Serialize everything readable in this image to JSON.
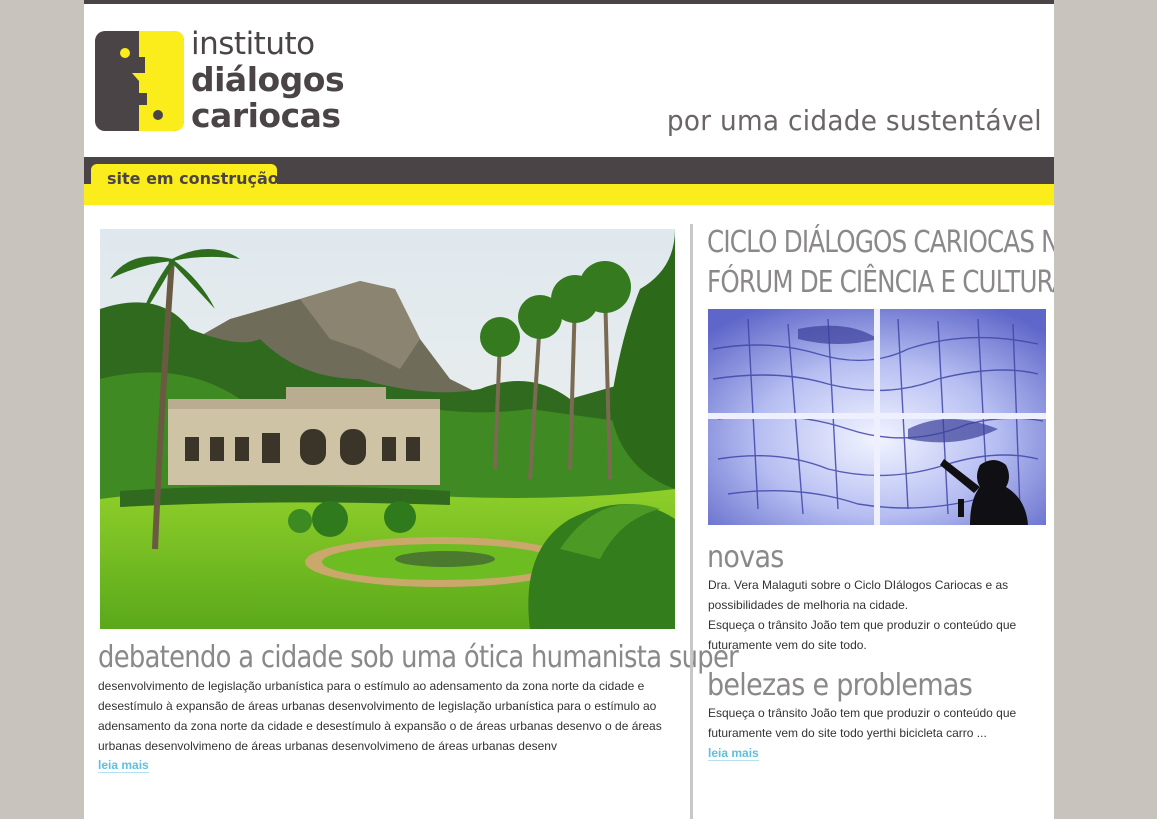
{
  "brand": {
    "line1": "instituto",
    "line2": "diálogos",
    "line3": "cariocas",
    "tagline": "por uma cidade sustentável"
  },
  "nav": {
    "tab_label": "site em construção"
  },
  "main": {
    "heading": "debatendo a cidade sob uma ótica humanista super",
    "body": "desenvolvimento de legislação urbanística para o estímulo ao adensamento da zona norte da cidade e desestímulo à expansão de áreas urbanas desenvolvimento de legislação urbanística para o estímulo ao adensamento da zona norte da cidade e desestímulo à expansão o de áreas urbanas desenvo o de áreas urbanas desenvolvimeno de áreas urbanas desenvolvimeno de áreas urbanas desenv",
    "more_label": "leia mais"
  },
  "sidebar": {
    "heading_line1": "Ciclo Diálogos Cariocas no",
    "heading_line2": "Fórum de Ciência e Cultura",
    "novas": {
      "title": "novas",
      "items": [
        "Dra. Vera Malaguti sobre o Ciclo DIálogos Cariocas e as possibilidades de melhoria na cidade.",
        "Esqueça o trânsito João tem que produzir o conteúdo que futuramente vem do site todo."
      ]
    },
    "belezas": {
      "title": "belezas e problemas",
      "text": "Esqueça o trânsito João tem que produzir o conteúdo que futuramente vem do site todo yerthi bicicleta carro ...",
      "more_label": "leia mais"
    }
  },
  "colors": {
    "brand_dark": "#4a4446",
    "brand_yellow": "#fbed1c",
    "link": "#5fc0dc",
    "heading_gray": "#8b8889",
    "page_bg": "#c8c4bd"
  },
  "icons": {
    "logo": "face-profile-logo-icon"
  }
}
